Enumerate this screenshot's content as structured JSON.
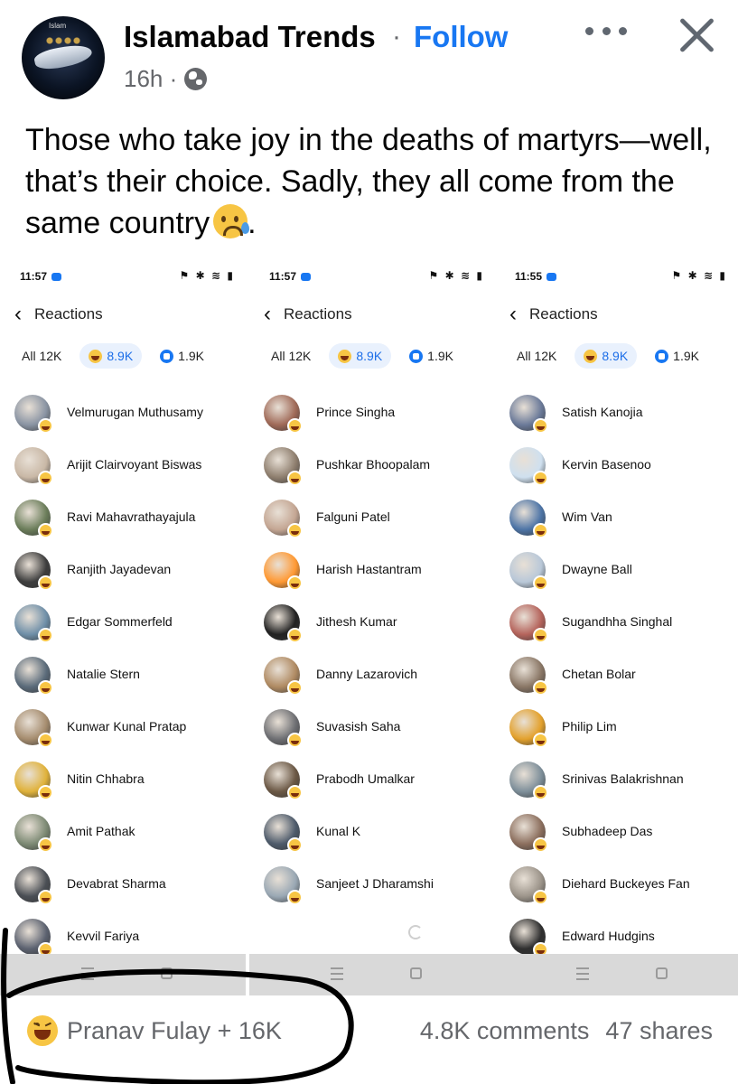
{
  "post": {
    "page_name": "Islamabad Trends",
    "separator": "·",
    "follow_label": "Follow",
    "time": "16h ·",
    "avatar_text": "Islam",
    "text": "Those who take joy in the deaths of martyrs—well, that’s their choice. Sadly, they all come from the same country",
    "text_end": ".",
    "emoji": "sad-tear-emoji"
  },
  "screenshots": [
    {
      "time": "11:57",
      "status_icons": "⚑ ✱ ≋ ▮",
      "back": "‹",
      "title": "Reactions",
      "tabs": {
        "all": "All 12K",
        "haha": "8.9K",
        "like": "1.9K"
      },
      "names": [
        "Velmurugan Muthusamy",
        "Arijit Clairvoyant Biswas",
        "Ravi Mahavrathayajula",
        "Ranjith Jayadevan",
        "Edgar Sommerfeld",
        "Natalie Stern",
        "Kunwar Kunal Pratap",
        "Nitin Chhabra",
        "Amit Pathak",
        "Devabrat Sharma",
        "Kevvil Fariya"
      ]
    },
    {
      "time": "11:57",
      "status_icons": "⚑ ✱ ≋ ▮",
      "back": "‹",
      "title": "Reactions",
      "tabs": {
        "all": "All 12K",
        "haha": "8.9K",
        "like": "1.9K"
      },
      "names": [
        "Prince Singha",
        "Pushkar Bhoopalam",
        "Falguni Patel",
        "Harish Hastantram",
        "Jithesh Kumar",
        "Danny Lazarovich",
        "Suvasish Saha",
        "Prabodh Umalkar",
        "Kunal K",
        "Sanjeet J Dharamshi"
      ]
    },
    {
      "time": "11:55",
      "status_icons": "⚑ ✱ ≋ ▮",
      "back": "‹",
      "title": "Reactions",
      "tabs": {
        "all": "All 12K",
        "haha": "8.9K",
        "like": "1.9K"
      },
      "names": [
        "Satish Kanojia",
        "Kervin Basenoo",
        "Wim Van",
        "Dwayne Ball",
        "Sugandhha Singhal",
        "Chetan Bolar",
        "Philip Lim",
        "Srinivas Balakrishnan",
        "Subhadeep Das",
        "Diehard Buckeyes Fan",
        "Edward Hudgins"
      ]
    }
  ],
  "footer": {
    "reactions": "Pranav Fulay + 16K",
    "comments": "4.8K comments",
    "shares": "47 shares"
  },
  "colors": {
    "brand_blue": "#1877f2",
    "secondary_text": "#65676b",
    "haha_yellow": "#f7c544"
  }
}
